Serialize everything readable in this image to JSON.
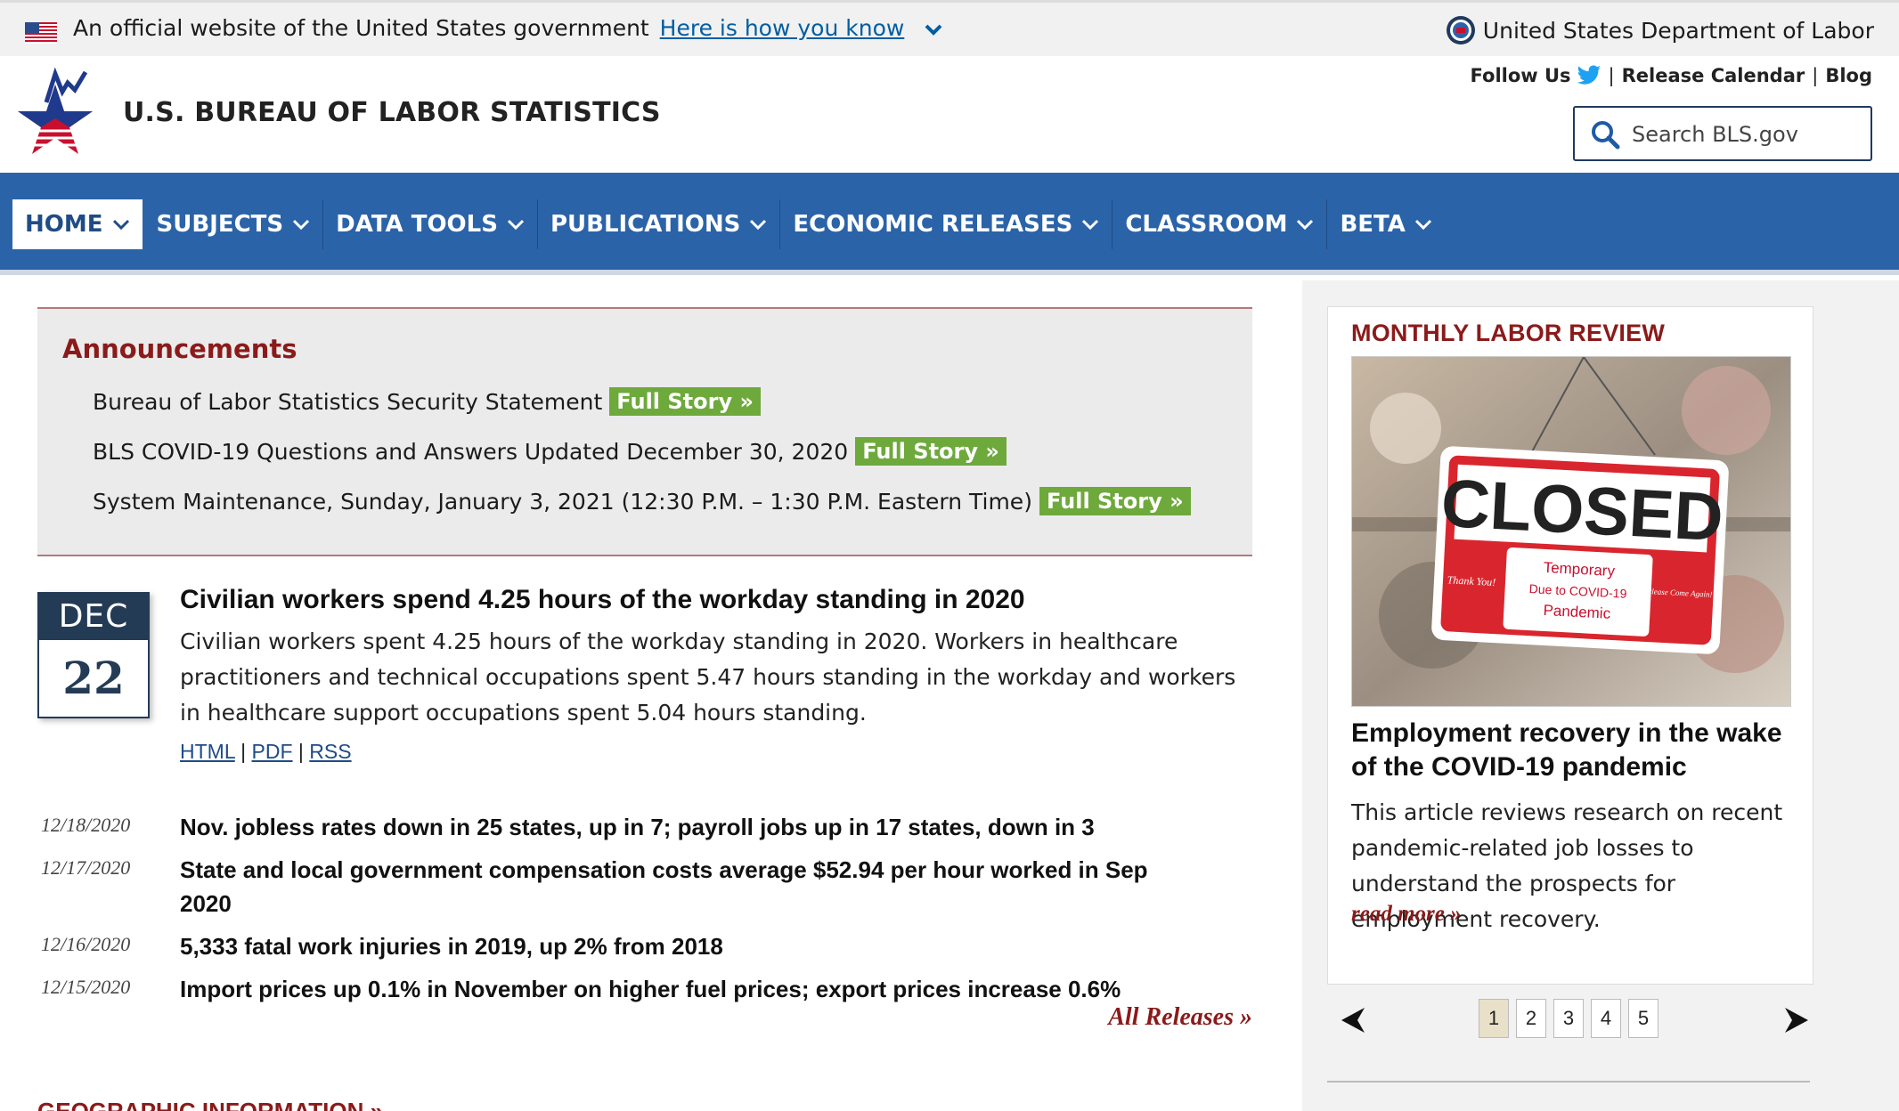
{
  "gov_banner": {
    "text": "An official website of the United States government",
    "link": "Here is how you know",
    "agency": "United States Department of Labor"
  },
  "header": {
    "site_title": "U.S. BUREAU OF LABOR STATISTICS",
    "follow_us": "Follow Us",
    "release_calendar": "Release Calendar",
    "blog": "Blog",
    "sep": "|",
    "search_placeholder": "Search BLS.gov"
  },
  "nav": {
    "items": [
      {
        "label": "HOME"
      },
      {
        "label": "SUBJECTS"
      },
      {
        "label": "DATA TOOLS"
      },
      {
        "label": "PUBLICATIONS"
      },
      {
        "label": "ECONOMIC RELEASES"
      },
      {
        "label": "CLASSROOM"
      },
      {
        "label": "BETA"
      }
    ]
  },
  "announcements": {
    "title": "Announcements",
    "items": [
      {
        "text": "Bureau of Labor Statistics Security Statement",
        "cta": "Full Story »"
      },
      {
        "text": "BLS COVID-19 Questions and Answers Updated December 30, 2020",
        "cta": "Full Story »"
      },
      {
        "text": "System Maintenance, Sunday, January 3, 2021 (12:30 P.M. – 1:30 P.M. Eastern Time)",
        "cta": "Full Story »"
      }
    ]
  },
  "feature": {
    "month": "DEC",
    "day": "22",
    "headline": "Civilian workers spend 4.25 hours of the workday standing in 2020",
    "body": "Civilian workers spent 4.25 hours of the workday standing in 2020. Workers in healthcare practitioners and technical occupations spent 5.47 hours standing in the workday and workers in healthcare support occupations spent 5.04 hours standing.",
    "links": [
      "HTML",
      "PDF",
      "RSS"
    ],
    "link_sep": "|"
  },
  "releases": {
    "items": [
      {
        "date": "12/18/2020",
        "title": "Nov. jobless rates down in 25 states, up in 7; payroll jobs up in 17 states, down in 3"
      },
      {
        "date": "12/17/2020",
        "title": "State and local government compensation costs average $52.94 per hour worked in Sep 2020"
      },
      {
        "date": "12/16/2020",
        "title": "5,333 fatal work injuries in 2019, up 2% from 2018"
      },
      {
        "date": "12/15/2020",
        "title": "Import prices up 0.1% in November on higher fuel prices; export prices increase 0.6%"
      }
    ],
    "all_link": "All Releases »"
  },
  "geo_heading": "GEOGRAPHIC INFORMATION »",
  "sidebar": {
    "title": "MONTHLY LABOR REVIEW",
    "image_sign": {
      "closed": "CLOSED",
      "line1": "Temporary",
      "line2": "Due to COVID-19",
      "line3": "Pandemic",
      "left": "Thank You!",
      "right": "Please Come Again!"
    },
    "headline": "Employment recovery in the wake of the COVID-19 pandemic",
    "body": "This article reviews research on recent pandemic-related job losses to understand the prospects for employment recovery.",
    "read_more": "read more »",
    "pages": [
      "1",
      "2",
      "3",
      "4",
      "5"
    ],
    "current_page": "1"
  },
  "colors": {
    "nav_blue": "#2b63a9",
    "accent_red": "#8b1a1a",
    "full_story_green": "#6ea93c",
    "date_navy": "#243b55"
  }
}
